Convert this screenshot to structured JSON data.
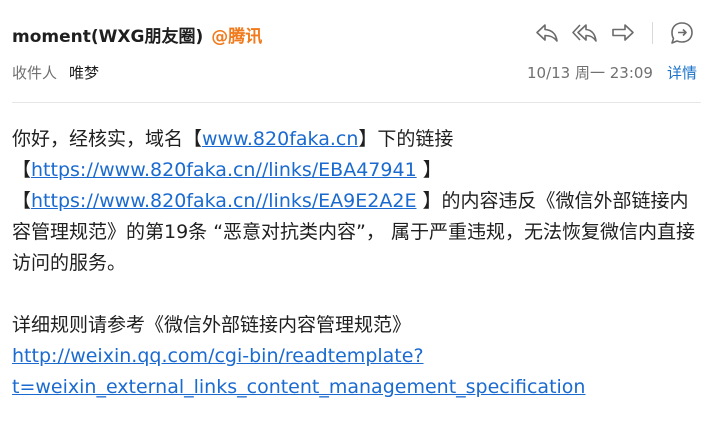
{
  "header": {
    "sender_name": "moment(WXG朋友圈)",
    "sender_org": "@腾讯",
    "recipient_label": "收件人",
    "recipient_name": "唯梦",
    "datetime": "10/13 周一 23:09",
    "details_label": "详情"
  },
  "toolbar": {
    "icons": [
      "reply-icon",
      "reply-all-icon",
      "forward-icon",
      "more-options-icon"
    ]
  },
  "body": {
    "p1_text1": "你好，经核实，域名【",
    "p1_link1": "www.820faka.cn",
    "p1_text2": "】下的链接",
    "p1_open2": "【",
    "p1_link2": "https://www.820faka.cn//links/EBA47941",
    "p1_close2": " 】",
    "p1_open3": "【",
    "p1_link3": "https://www.820faka.cn//links/EA9E2A2E",
    "p1_text3": " 】的内容违反《微信外部链接内容管理规范》的第19条 “恶意对抗类内容”， 属于严重违规，无法恢复微信内直接访问的服务。",
    "p2_text1": "详细规则请参考《微信外部链接内容管理规范》",
    "p2_link": "http://weixin.qq.com/cgi-bin/readtemplate?t=weixin_external_links_content_management_specification"
  },
  "colors": {
    "link": "#1a6ad0",
    "org": "#f07a1c",
    "details": "#1a73c9"
  }
}
